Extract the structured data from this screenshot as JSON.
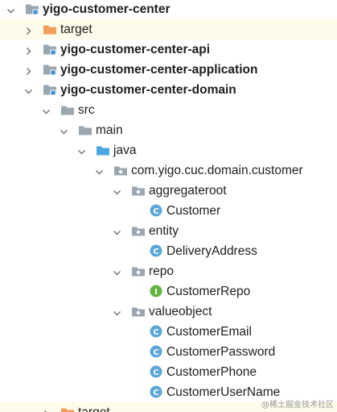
{
  "tree": [
    {
      "label": "yigo-customer-center",
      "bold": true,
      "depth": 0,
      "expanded": true,
      "icon": "module-folder-icon",
      "highlight": false
    },
    {
      "label": "target",
      "bold": false,
      "depth": 1,
      "expanded": false,
      "icon": "excluded-folder-icon",
      "highlight": true
    },
    {
      "label": "yigo-customer-center-api",
      "bold": true,
      "depth": 1,
      "expanded": false,
      "icon": "module-folder-icon",
      "highlight": false
    },
    {
      "label": "yigo-customer-center-application",
      "bold": true,
      "depth": 1,
      "expanded": false,
      "icon": "module-folder-icon",
      "highlight": false
    },
    {
      "label": "yigo-customer-center-domain",
      "bold": true,
      "depth": 1,
      "expanded": true,
      "icon": "module-folder-icon",
      "highlight": false
    },
    {
      "label": "src",
      "bold": false,
      "depth": 2,
      "expanded": true,
      "icon": "folder-icon",
      "highlight": false
    },
    {
      "label": "main",
      "bold": false,
      "depth": 3,
      "expanded": true,
      "icon": "folder-icon",
      "highlight": false
    },
    {
      "label": "java",
      "bold": false,
      "depth": 4,
      "expanded": true,
      "icon": "source-folder-icon",
      "highlight": false
    },
    {
      "label": "com.yigo.cuc.domain.customer",
      "bold": false,
      "depth": 5,
      "expanded": true,
      "icon": "package-icon",
      "highlight": false
    },
    {
      "label": "aggregateroot",
      "bold": false,
      "depth": 6,
      "expanded": true,
      "icon": "package-icon",
      "highlight": false
    },
    {
      "label": "Customer",
      "bold": false,
      "depth": 7,
      "expanded": null,
      "icon": "class-icon",
      "highlight": false
    },
    {
      "label": "entity",
      "bold": false,
      "depth": 6,
      "expanded": true,
      "icon": "package-icon",
      "highlight": false
    },
    {
      "label": "DeliveryAddress",
      "bold": false,
      "depth": 7,
      "expanded": null,
      "icon": "class-icon",
      "highlight": false
    },
    {
      "label": "repo",
      "bold": false,
      "depth": 6,
      "expanded": true,
      "icon": "package-icon",
      "highlight": false
    },
    {
      "label": "CustomerRepo",
      "bold": false,
      "depth": 7,
      "expanded": null,
      "icon": "interface-icon",
      "highlight": false
    },
    {
      "label": "valueobject",
      "bold": false,
      "depth": 6,
      "expanded": true,
      "icon": "package-icon",
      "highlight": false
    },
    {
      "label": "CustomerEmail",
      "bold": false,
      "depth": 7,
      "expanded": null,
      "icon": "class-icon",
      "highlight": false
    },
    {
      "label": "CustomerPassword",
      "bold": false,
      "depth": 7,
      "expanded": null,
      "icon": "class-icon",
      "highlight": false
    },
    {
      "label": "CustomerPhone",
      "bold": false,
      "depth": 7,
      "expanded": null,
      "icon": "class-icon",
      "highlight": false
    },
    {
      "label": "CustomerUserName",
      "bold": false,
      "depth": 7,
      "expanded": null,
      "icon": "class-icon",
      "highlight": false
    },
    {
      "label": "target",
      "bold": false,
      "depth": 2,
      "expanded": false,
      "icon": "excluded-folder-icon",
      "highlight": true
    }
  ],
  "watermark": "@稀土掘金技术社区",
  "colors": {
    "arrow": "#6e6e6e",
    "folder": "#9aa7b0",
    "excluded_folder": "#f19f5a",
    "source_folder": "#4aa8e0",
    "module_marker": "#3d8fd1",
    "class_icon": "#5aa6d6",
    "interface_icon": "#62b543",
    "row_highlight": "#fdfbe9"
  }
}
